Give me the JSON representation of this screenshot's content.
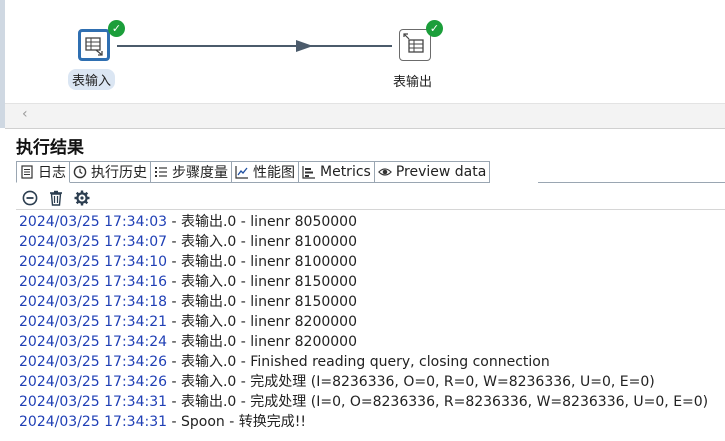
{
  "canvas": {
    "steps": [
      {
        "label": "表输入",
        "status_icon": "success-check-icon",
        "icon": "table-input-icon",
        "selected": true
      },
      {
        "label": "表输出",
        "status_icon": "success-check-icon",
        "icon": "table-output-icon",
        "selected": false
      }
    ],
    "hop_icon": "arrow-right-icon"
  },
  "scrollbar": {
    "left_arrow": "‹"
  },
  "results": {
    "title": "执行结果",
    "tabs": [
      {
        "label": "日志",
        "icon": "document-icon",
        "active": true
      },
      {
        "label": "执行历史",
        "icon": "clock-icon"
      },
      {
        "label": "步骤度量",
        "icon": "list-icon"
      },
      {
        "label": "性能图",
        "icon": "line-chart-icon"
      },
      {
        "label": "Metrics",
        "icon": "metrics-icon"
      },
      {
        "label": "Preview data",
        "icon": "eye-icon"
      }
    ],
    "toolbar": [
      {
        "name": "stop-icon"
      },
      {
        "name": "trash-icon"
      },
      {
        "name": "settings-icon"
      }
    ]
  },
  "log": [
    {
      "ts": "2024/03/25 17:34:03",
      "msg": " - 表输出.0 - linenr 8050000"
    },
    {
      "ts": "2024/03/25 17:34:07",
      "msg": " - 表输入.0 - linenr 8100000"
    },
    {
      "ts": "2024/03/25 17:34:10",
      "msg": " - 表输出.0 - linenr 8100000"
    },
    {
      "ts": "2024/03/25 17:34:16",
      "msg": " - 表输入.0 - linenr 8150000"
    },
    {
      "ts": "2024/03/25 17:34:18",
      "msg": " - 表输出.0 - linenr 8150000"
    },
    {
      "ts": "2024/03/25 17:34:21",
      "msg": " - 表输入.0 - linenr 8200000"
    },
    {
      "ts": "2024/03/25 17:34:24",
      "msg": " - 表输出.0 - linenr 8200000"
    },
    {
      "ts": "2024/03/25 17:34:26",
      "msg": " - 表输入.0 - Finished reading query, closing connection"
    },
    {
      "ts": "2024/03/25 17:34:26",
      "msg": " - 表输入.0 - 完成处理 (I=8236336, O=0, R=0, W=8236336, U=0, E=0)"
    },
    {
      "ts": "2024/03/25 17:34:31",
      "msg": " - 表输出.0 - 完成处理 (I=0, O=8236336, R=8236336, W=8236336, U=0, E=0)"
    },
    {
      "ts": "2024/03/25 17:34:31",
      "msg": " - Spoon - 转换完成!!"
    }
  ]
}
